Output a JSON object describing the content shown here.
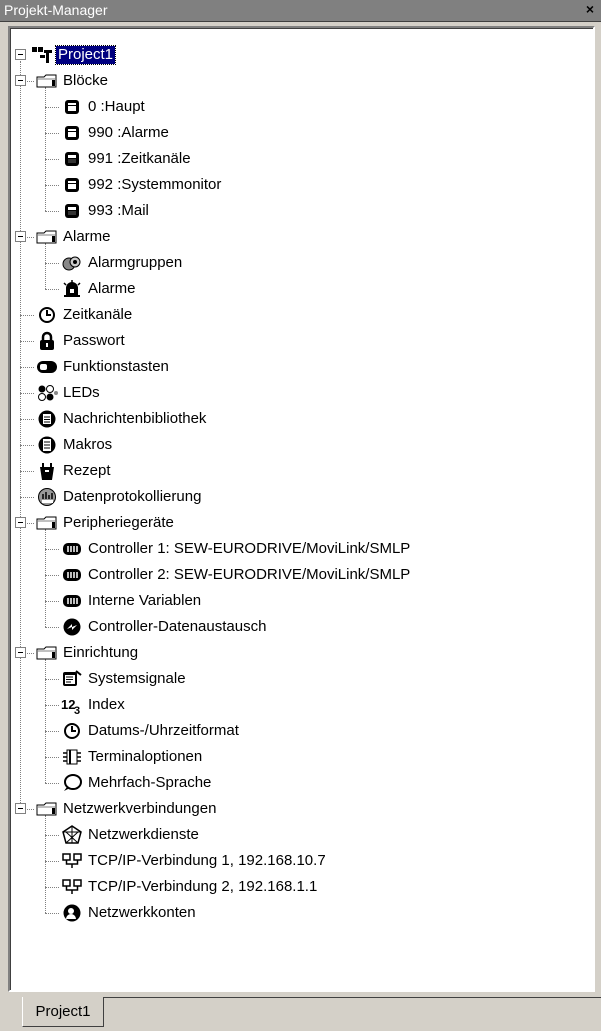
{
  "window": {
    "title": "Projekt-Manager",
    "close_glyph": "×"
  },
  "tree": {
    "root": {
      "label": "Project1",
      "icon": "project-icon",
      "selected": true
    },
    "items": [
      {
        "label": "Blöcke",
        "icon": "folder-icon",
        "level": 1,
        "expanded": true
      },
      {
        "label": "0 :Haupt",
        "icon": "block-icon",
        "level": 2
      },
      {
        "label": "990 :Alarme",
        "icon": "block-icon",
        "level": 2
      },
      {
        "label": "991 :Zeitkanäle",
        "icon": "block-filled-icon",
        "level": 2
      },
      {
        "label": "992 :Systemmonitor",
        "icon": "block-icon",
        "level": 2
      },
      {
        "label": "993 :Mail",
        "icon": "block-filled-icon",
        "level": 2
      },
      {
        "label": "Alarme",
        "icon": "folder-icon",
        "level": 1,
        "expanded": true
      },
      {
        "label": "Alarmgruppen",
        "icon": "alarm-groups-icon",
        "level": 2
      },
      {
        "label": "Alarme",
        "icon": "alarm-icon",
        "level": 2
      },
      {
        "label": "Zeitkanäle",
        "icon": "clock-icon",
        "level": 1
      },
      {
        "label": "Passwort",
        "icon": "lock-icon",
        "level": 1
      },
      {
        "label": "Funktionstasten",
        "icon": "function-key-icon",
        "level": 1
      },
      {
        "label": "LEDs",
        "icon": "leds-icon",
        "level": 1
      },
      {
        "label": "Nachrichtenbibliothek",
        "icon": "message-library-icon",
        "level": 1
      },
      {
        "label": "Makros",
        "icon": "macro-icon",
        "level": 1
      },
      {
        "label": "Rezept",
        "icon": "recipe-icon",
        "level": 1
      },
      {
        "label": "Datenprotokollierung",
        "icon": "data-log-icon",
        "level": 1
      },
      {
        "label": "Peripheriegeräte",
        "icon": "folder-icon",
        "level": 1,
        "expanded": true
      },
      {
        "label": "Controller 1: SEW-EURODRIVE/MoviLink/SMLP",
        "icon": "controller-icon",
        "level": 2
      },
      {
        "label": "Controller 2: SEW-EURODRIVE/MoviLink/SMLP",
        "icon": "controller-icon",
        "level": 2
      },
      {
        "label": "Interne Variablen",
        "icon": "controller-icon",
        "level": 2
      },
      {
        "label": "Controller-Datenaustausch",
        "icon": "data-exchange-icon",
        "level": 2
      },
      {
        "label": "Einrichtung",
        "icon": "folder-icon",
        "level": 1,
        "expanded": true
      },
      {
        "label": "Systemsignale",
        "icon": "system-signal-icon",
        "level": 2
      },
      {
        "label": "Index",
        "icon": "index-icon",
        "level": 2
      },
      {
        "label": "Datums-/Uhrzeitformat",
        "icon": "clock-icon",
        "level": 2
      },
      {
        "label": "Terminaloptionen",
        "icon": "terminal-options-icon",
        "level": 2
      },
      {
        "label": "Mehrfach-Sprache",
        "icon": "speech-bubble-icon",
        "level": 2
      },
      {
        "label": "Netzwerkverbindungen",
        "icon": "folder-icon",
        "level": 1,
        "expanded": true
      },
      {
        "label": "Netzwerkdienste",
        "icon": "network-services-icon",
        "level": 2
      },
      {
        "label": "TCP/IP-Verbindung 1, 192.168.10.7",
        "icon": "network-connection-icon",
        "level": 2
      },
      {
        "label": "TCP/IP-Verbindung 2, 192.168.1.1",
        "icon": "network-connection-icon",
        "level": 2
      },
      {
        "label": "Netzwerkkonten",
        "icon": "network-account-icon",
        "level": 2
      }
    ]
  },
  "tabs": [
    {
      "label": "Project1",
      "active": true
    }
  ],
  "colors": {
    "selection": "#000080",
    "titlebar": "#808080",
    "face": "#d4d0c8"
  }
}
